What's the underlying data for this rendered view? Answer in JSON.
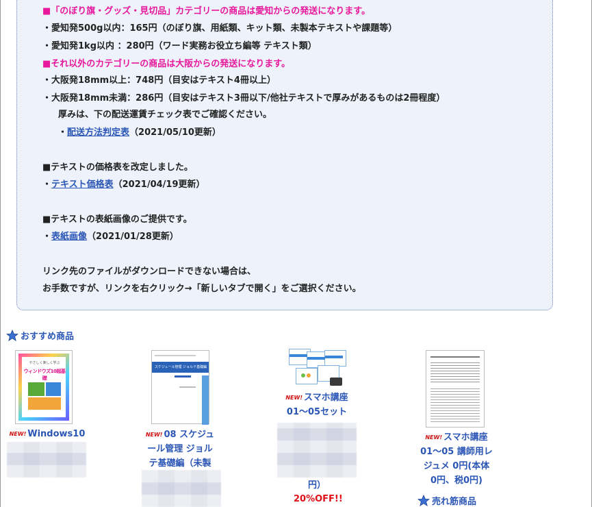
{
  "info": {
    "line1": "■「のぼり旗・グッズ・見切品」カテゴリーの商品は愛知からの発送になります。",
    "line2": "・愛知発500g以内：165円（のぼり旗、用紙類、キット類、未製本テキストや課題等）",
    "line3": "・愛知発1kg以内 ：280円（ワード実務お役立ち編等 テキスト類）",
    "line4": "■それ以外のカテゴリーの商品は大阪からの発送になります。",
    "line5": "・大阪発18mm以上：748円（目安はテキスト4冊以上）",
    "line6": "・大阪発18mm未満：286円（目安はテキスト3冊以下/他社テキストで厚みがあるものは2冊程度）",
    "line7": "厚みは、下の配送運賃チェック表でご確認ください。",
    "shipping_prefix": "・",
    "shipping_link": "配送方法判定表",
    "shipping_date": "（2021/05/10更新）",
    "price_heading": "■テキストの価格表を改定しました。",
    "price_prefix": "・",
    "price_link": "テキスト価格表",
    "price_date": "（2021/04/19更新）",
    "cover_heading": "■テキストの表紙画像のご提供です。",
    "cover_prefix": "・",
    "cover_link": "表紙画像",
    "cover_date": "（2021/01/28更新）",
    "note1": "リンク先のファイルがダウンロードできない場合は、",
    "note2": "お手数ですが、リンクを右クリック→「新しいタブで開く」をご選択ください。"
  },
  "recommended": {
    "title": "おすすめ商品",
    "new_badge": "NEW!",
    "products": [
      {
        "line1": "Windows10"
      },
      {
        "line1": "08 スケジュ",
        "line2": "ール管理 ジョル",
        "line3": "テ基礎編（未製"
      },
      {
        "line1": "スマホ講座",
        "line2": "01～05セット",
        "tail": "円）",
        "discount": "20%OFF!!"
      },
      {
        "line1": "スマホ講座",
        "line2": "01～05 講師用レ",
        "line3": "ジュメ 0円(本体",
        "line4": "0円、税0円)"
      }
    ]
  },
  "bestsellers": {
    "title": "売れ筋商品"
  },
  "thumb_texts": {
    "windows_cover": "ウィンドウズ10超基礎",
    "windows_small": "やさしく楽しく学ぶ",
    "schedule_cover": "スケジュール管理 ジョルテ基礎編"
  }
}
